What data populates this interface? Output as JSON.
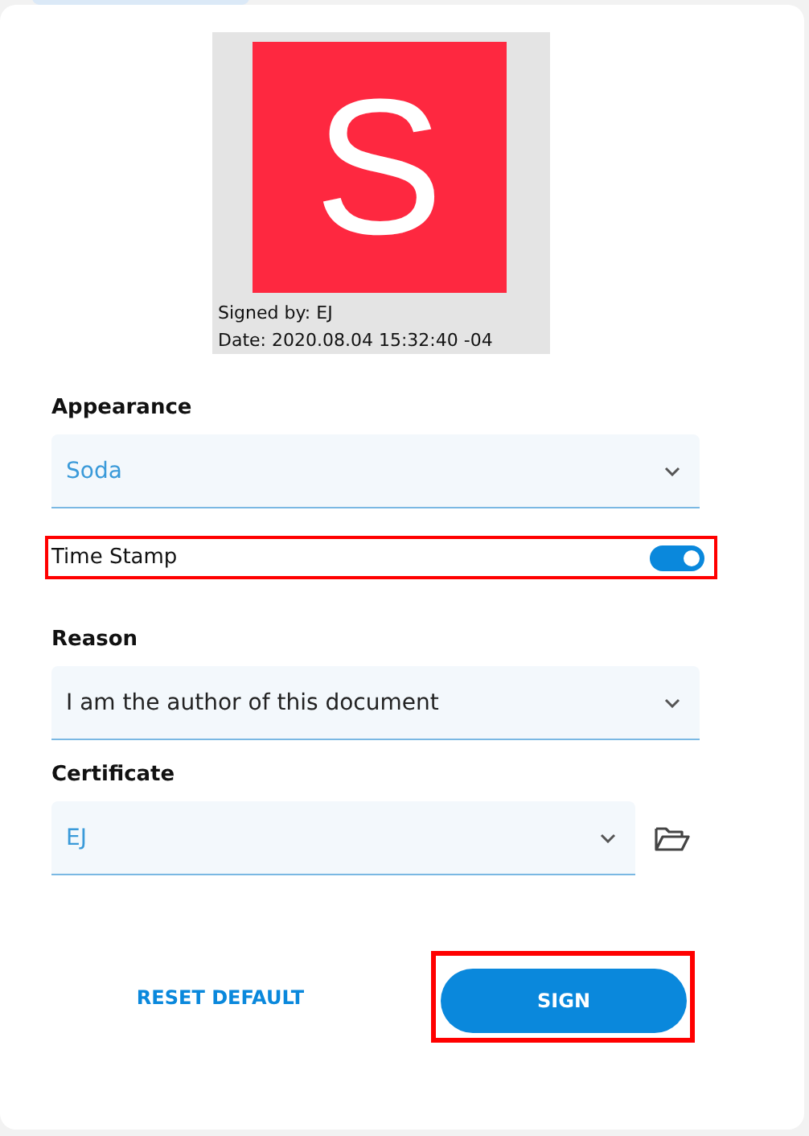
{
  "preview": {
    "logo_letter": "S",
    "signed_by": "Signed by: EJ",
    "date": "Date: 2020.08.04 15:32:40 -04"
  },
  "appearance": {
    "label": "Appearance",
    "value": "Soda"
  },
  "time_stamp": {
    "label": "Time Stamp",
    "on": true,
    "highlighted": true
  },
  "reason": {
    "label": "Reason",
    "value": "I am the author of this document"
  },
  "certificate": {
    "label": "Certificate",
    "value": "EJ"
  },
  "buttons": {
    "reset": "RESET DEFAULT",
    "sign": "SIGN",
    "sign_highlighted": true
  }
}
